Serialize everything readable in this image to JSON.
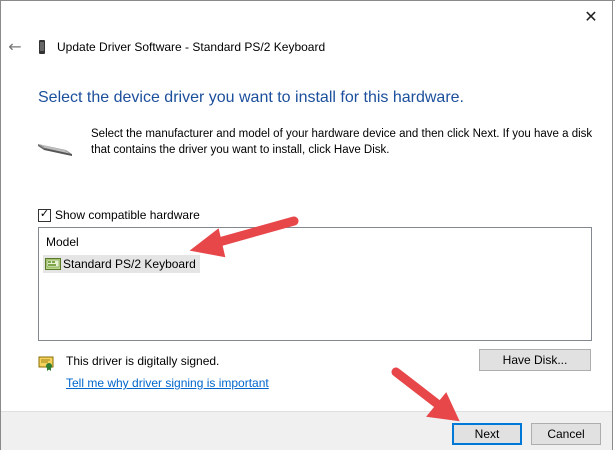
{
  "window": {
    "title": "Update Driver Software - Standard PS/2 Keyboard",
    "close_glyph": "✕",
    "back_glyph": "←"
  },
  "page": {
    "heading": "Select the device driver you want to install for this hardware.",
    "instructions": "Select the manufacturer and model of your hardware device and then click Next. If you have a disk that contains the driver you want to install, click Have Disk."
  },
  "compatible": {
    "label": "Show compatible hardware",
    "checked": true,
    "check_glyph": "✓"
  },
  "model_list": {
    "header": "Model",
    "items": [
      {
        "label": "Standard PS/2 Keyboard",
        "icon": "keyboard-driver-icon",
        "selected": true
      }
    ]
  },
  "signing": {
    "status": "This driver is digitally signed.",
    "link": "Tell me why driver signing is important",
    "icon": "signed-certificate-icon"
  },
  "buttons": {
    "have_disk": "Have Disk...",
    "next": "Next",
    "cancel": "Cancel"
  },
  "annotations": {
    "arrow_color": "#e8474a",
    "accent_color": "#0078d7",
    "heading_color": "#1c4f9c",
    "link_color": "#0066cc"
  }
}
